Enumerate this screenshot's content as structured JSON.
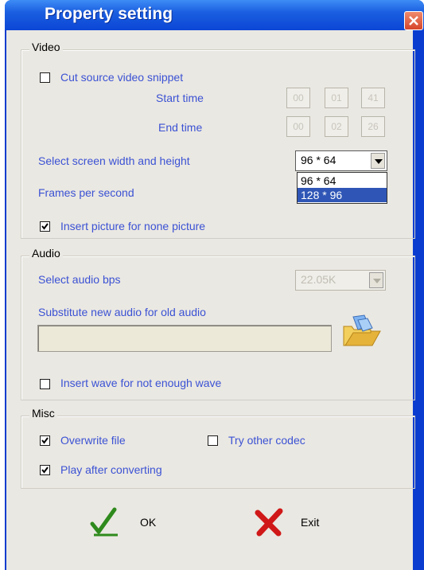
{
  "window": {
    "title": "Property setting"
  },
  "video": {
    "group_title": "Video",
    "cut_label": "Cut source video snippet",
    "cut_checked": false,
    "start_label": "Start time",
    "start": [
      "00",
      "01",
      "41"
    ],
    "end_label": "End time",
    "end": [
      "00",
      "02",
      "26"
    ],
    "screen_label": "Select screen width and height",
    "screen_value": "96 * 64",
    "screen_options": [
      "96 * 64",
      "128 * 96"
    ],
    "screen_highlighted": "128 * 96",
    "fps_label": "Frames per second",
    "insert_picture_label": "Insert picture for none picture",
    "insert_picture_checked": true
  },
  "audio": {
    "group_title": "Audio",
    "bps_label": "Select audio bps",
    "bps_value": "22.05K",
    "substitute_label": "Substitute new audio for old audio",
    "substitute_value": "",
    "insert_wave_label": "Insert wave for not enough wave",
    "insert_wave_checked": false
  },
  "misc": {
    "group_title": "Misc",
    "overwrite_label": "Overwrite file",
    "overwrite_checked": true,
    "try_codec_label": "Try other codec",
    "try_codec_checked": false,
    "play_after_label": "Play after converting",
    "play_after_checked": true
  },
  "buttons": {
    "ok_label": "OK",
    "exit_label": "Exit"
  },
  "colors": {
    "title_bar": "#1b5fe0",
    "label_text": "#3b52d4",
    "highlight": "#2f56b6",
    "ok_icon": "#2e8a1c",
    "exit_icon": "#d01818"
  },
  "icons": [
    "close-icon",
    "checkmark-icon",
    "dropdown-arrow-icon",
    "folder-icon",
    "ok-check-icon",
    "exit-x-icon"
  ]
}
